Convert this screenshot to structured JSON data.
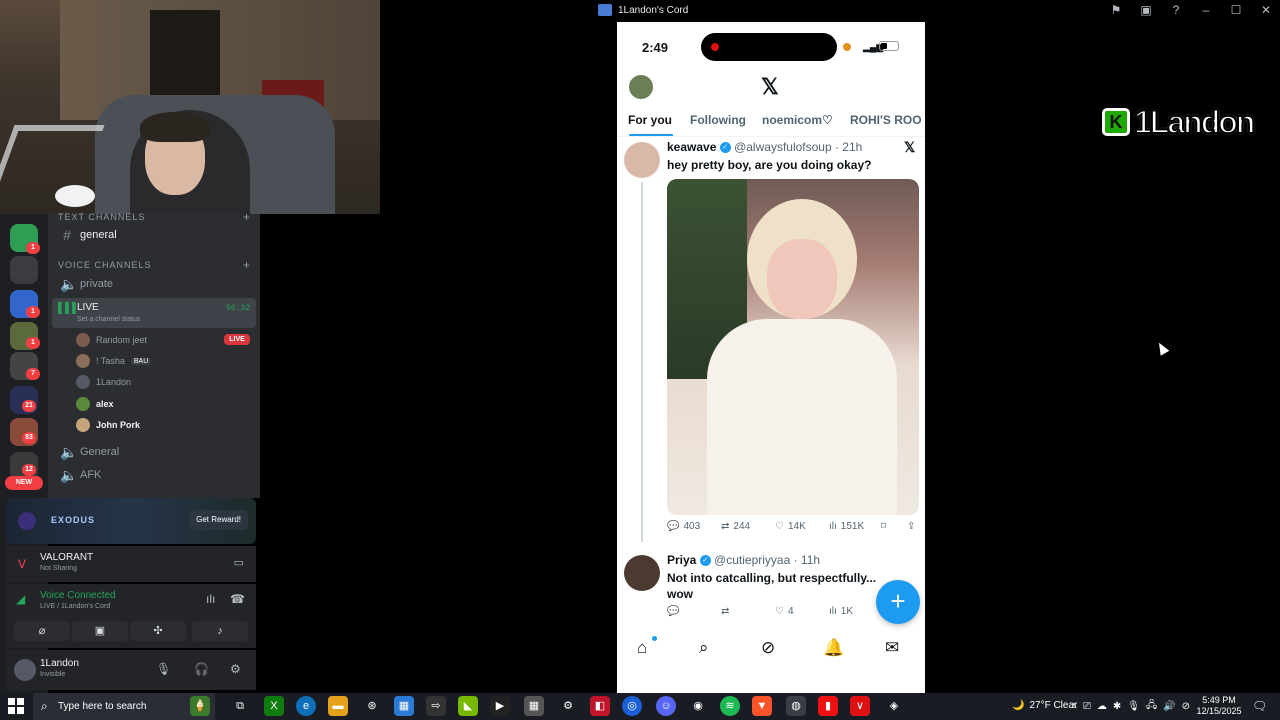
{
  "window": {
    "title": "1Landon's Cord"
  },
  "watermark": {
    "k": "K",
    "text": "1Landon"
  },
  "servers": {
    "badges": [
      "1",
      "1",
      "1",
      "7",
      "21",
      "83",
      "12"
    ],
    "new_label": "NEW"
  },
  "channels": {
    "text_category": "TEXT CHANNELS",
    "general": "general",
    "voice_category": "VOICE CHANNELS",
    "private": "private",
    "live": {
      "name": "LIVE",
      "status": "Set a channel status",
      "time": "56:32"
    },
    "users": [
      {
        "name": "Random jeet",
        "badge": "LIVE",
        "color": "#7a5c4c"
      },
      {
        "name": "! Tasha",
        "tag": "BAU",
        "color": "#8a6d5a"
      },
      {
        "name": "1Landon",
        "color": "#555a66"
      },
      {
        "name": "alex",
        "color": "#5b8a3c"
      },
      {
        "name": "John Pork",
        "color": "#c4a47a"
      }
    ],
    "general_voice": "General",
    "afk": "AFK"
  },
  "promo": {
    "brand": "EXODUS",
    "button": "Get Reward!"
  },
  "activity": {
    "game": "VALORANT",
    "status": "Not Sharing"
  },
  "voice": {
    "title": "Voice Connected",
    "subtitle": "LIVE / 1Landon's Cord"
  },
  "user": {
    "name": "1Landon",
    "status": "Invisible"
  },
  "phone": {
    "time": "2:49",
    "tabs": [
      "For you",
      "Following",
      "noemicom♡",
      "ROHI'S ROO"
    ],
    "tweet1": {
      "name": "keawave",
      "handle": "@alwaysfulofsoup · 21h",
      "text": "hey pretty boy, are you doing okay?",
      "replies": "403",
      "reposts": "244",
      "likes": "14K",
      "views": "151K"
    },
    "tweet2": {
      "name": "Priya",
      "handle": "@cutiepriyyaa · 11h",
      "text_line1": "Not into catcalling, but respectfully...",
      "text_line2": "wow",
      "likes": "4",
      "views": "1K"
    }
  },
  "taskbar": {
    "search_placeholder": "Type here to search",
    "weather": "27°F  Clear",
    "time": "5:49 PM",
    "date": "12/15/2025",
    "xbox_badge": "16"
  }
}
